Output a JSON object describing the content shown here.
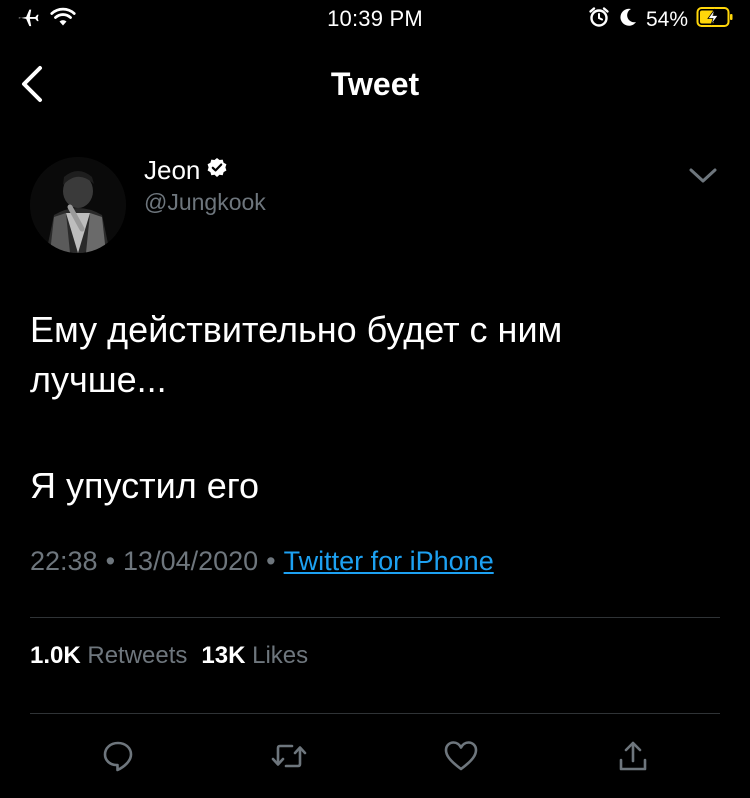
{
  "status_bar": {
    "time": "10:39 PM",
    "battery_percent": "54%",
    "battery_level": 0.54,
    "icons": [
      "airplane-icon",
      "wifi-icon",
      "alarm-icon",
      "moon-icon",
      "battery-charging-icon"
    ]
  },
  "nav": {
    "title": "Tweet",
    "back_icon": "chevron-left-icon"
  },
  "author": {
    "name": "Jeon",
    "handle": "@Jungkook",
    "verified": true,
    "menu_icon": "chevron-down-icon"
  },
  "tweet": {
    "lines": [
      "Ему действительно будет с ним",
      "лучше...",
      "Я упустил его"
    ]
  },
  "meta": {
    "time": "22:38",
    "date": "13/04/2020",
    "separator": "•",
    "source": "Twitter for iPhone"
  },
  "stats": {
    "retweets_count": "1.0K",
    "retweets_label": "Retweets",
    "likes_count": "13K",
    "likes_label": "Likes"
  },
  "actions": {
    "icons": [
      "reply-icon",
      "retweet-icon",
      "like-icon",
      "share-icon"
    ]
  },
  "colors": {
    "background": "#000000",
    "text": "#ffffff",
    "secondary": "#6e767d",
    "link": "#1da1f2",
    "divider": "#2f3336",
    "battery": "#ffd60a"
  }
}
